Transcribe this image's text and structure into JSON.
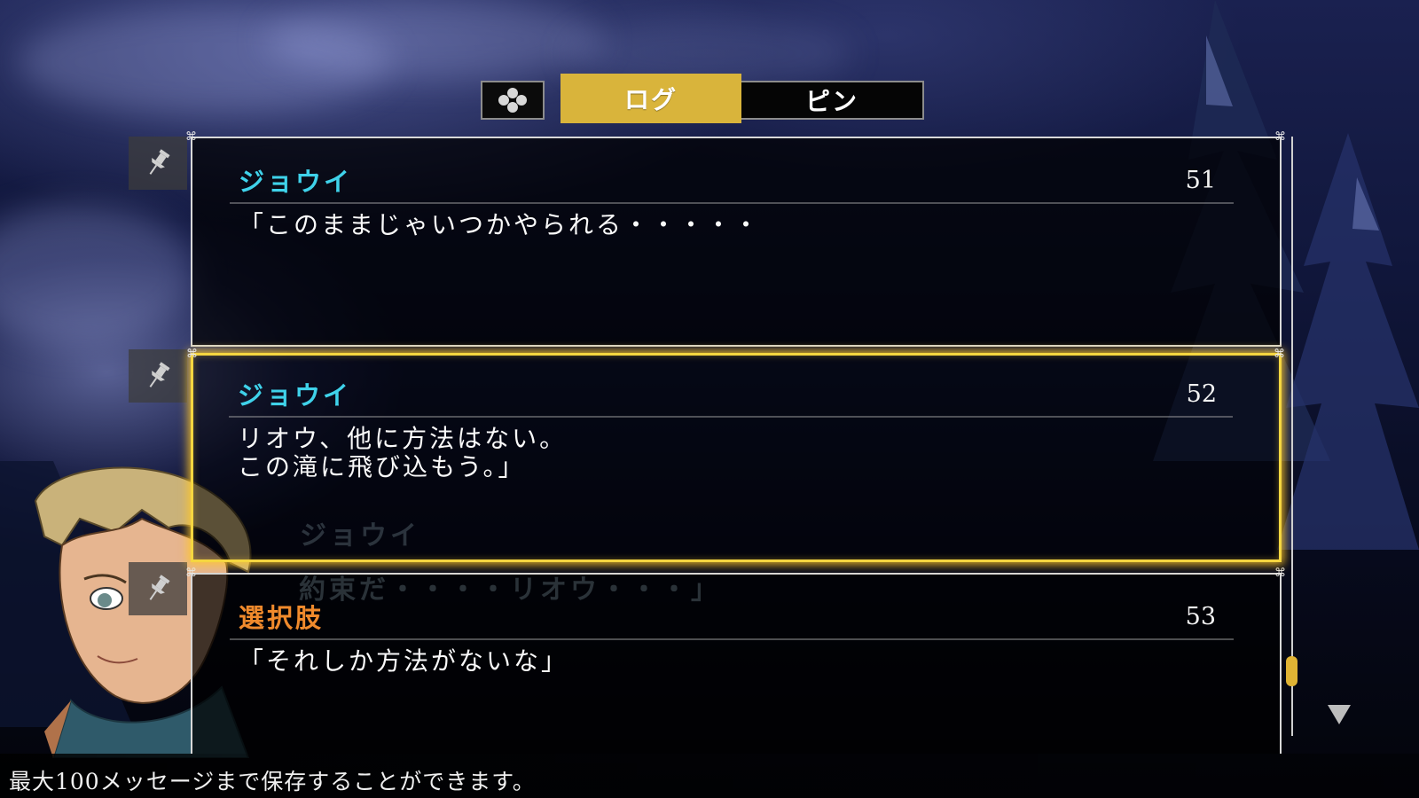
{
  "tabs": {
    "icon": "dpad-buttons-icon",
    "log_label": "ログ",
    "pin_label": "ピン",
    "active": "log"
  },
  "entries": [
    {
      "speaker": "ジョウイ",
      "speaker_color": "#3fd2ea",
      "number": "51",
      "message": "「このままじゃいつかやられる・・・・・",
      "pinned": false
    },
    {
      "speaker": "ジョウイ",
      "speaker_color": "#3fd2ea",
      "number": "52",
      "message": "リオウ、他に方法はない。\nこの滝に飛び込もう。」",
      "pinned": false,
      "selected": true
    },
    {
      "speaker": "選択肢",
      "speaker_color": "#f08a2c",
      "number": "53",
      "message": "「それしか方法がないな」",
      "pinned": false
    }
  ],
  "ghost_entry": {
    "speaker": "ジョウイ",
    "message": "約束だ・・・・リオウ・・・」"
  },
  "scrollbar": {
    "position_fraction": 0.87
  },
  "footer": {
    "hint": "最大100メッセージまで保存することができます。"
  },
  "colors": {
    "accent": "#d9b43b",
    "highlight": "#f5d640"
  }
}
